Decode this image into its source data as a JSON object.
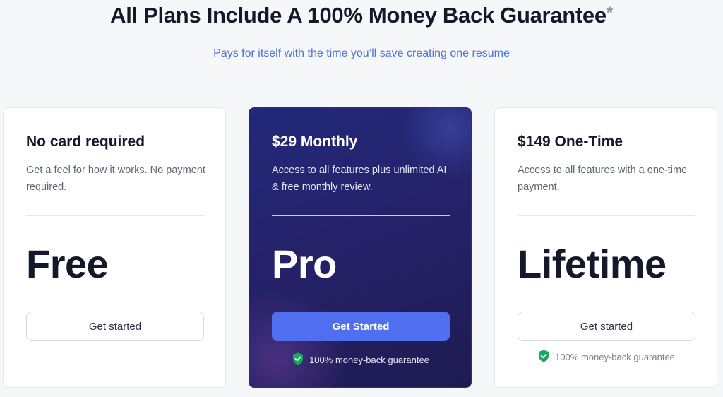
{
  "header": {
    "title": "All Plans Include A 100% Money Back Guarantee",
    "title_mark": "*",
    "subtitle": "Pays for itself with the time you’ll save creating one resume"
  },
  "plans": [
    {
      "name": "No card required",
      "description": "Get a feel for how it works. No payment required.",
      "tier": "Free",
      "cta_label": "Get started",
      "guarantee": ""
    },
    {
      "name": "$29 Monthly",
      "description": "Access to all features plus unlimited AI & free monthly review.",
      "tier": "Pro",
      "cta_label": "Get Started",
      "guarantee": "100% money-back guarantee"
    },
    {
      "name": "$149 One-Time",
      "description": "Access to all features with a one-time payment.",
      "tier": "Lifetime",
      "cta_label": "Get started",
      "guarantee": "100% money-back guarantee"
    }
  ],
  "icons": {
    "guarantee": "shield-check-icon"
  },
  "colors": {
    "accent": "#4f6ff0",
    "subtitle": "#4a72e0",
    "shield": "#1aa863",
    "pro_card_bg": "#24266f"
  }
}
